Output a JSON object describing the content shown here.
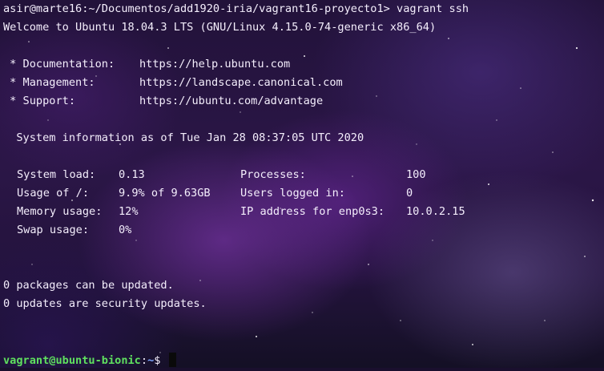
{
  "terminal": {
    "command_line": "asir@marte16:~/Documentos/add1920-iria/vagrant16-proyecto1> vagrant ssh",
    "welcome": "Welcome to Ubuntu 18.04.3 LTS (GNU/Linux 4.15.0-74-generic x86_64)",
    "links": [
      {
        "label": " * Documentation:",
        "url": "https://help.ubuntu.com"
      },
      {
        "label": " * Management:",
        "url": "https://landscape.canonical.com"
      },
      {
        "label": " * Support:",
        "url": "https://ubuntu.com/advantage"
      }
    ],
    "sysinfo_header": "  System information as of Tue Jan 28 08:37:05 UTC 2020",
    "stats": {
      "system_load_label": "System load:",
      "system_load_value": "0.13",
      "processes_label": "Processes:",
      "processes_value": "100",
      "usage_label": "Usage of /:",
      "usage_value": "9.9% of 9.63GB",
      "users_label": "Users logged in:",
      "users_value": "0",
      "memory_label": "Memory usage:",
      "memory_value": "12%",
      "ip_label": "IP address for enp0s3:",
      "ip_value": "10.0.2.15",
      "swap_label": "Swap usage:",
      "swap_value": "0%"
    },
    "packages": "0 packages can be updated.",
    "security": "0 updates are security updates.",
    "prompt": {
      "user_host": "vagrant@ubuntu-bionic",
      "colon": ":",
      "path": "~",
      "symbol": "$ "
    }
  },
  "colors": {
    "prompt_green": "#5fe05f",
    "path_blue": "#7da4ff",
    "text": "#f4eefc"
  }
}
